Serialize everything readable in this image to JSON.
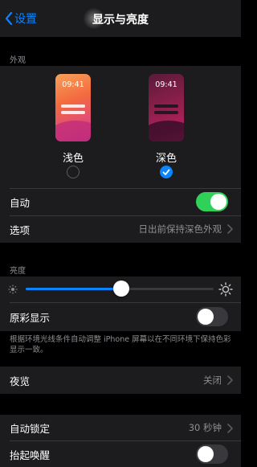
{
  "nav": {
    "back_label": "设置",
    "title": "显示与亮度"
  },
  "appearance": {
    "header": "外观",
    "light": {
      "label": "浅色",
      "time": "09:41",
      "selected": false
    },
    "dark": {
      "label": "深色",
      "time": "09:41",
      "selected": true
    },
    "auto": {
      "label": "自动",
      "on": true
    },
    "options": {
      "label": "选项",
      "value": "日出前保持深色外观"
    }
  },
  "brightness": {
    "header": "亮度",
    "level": 0.51,
    "true_tone": {
      "label": "原彩显示",
      "on": false,
      "footnote": "根据环境光线条件自动调整 iPhone 屏幕以在不同环境下保持色彩显示一致。"
    }
  },
  "night_shift": {
    "label": "夜览",
    "value": "关闭"
  },
  "auto_lock": {
    "label": "自动锁定",
    "value": "30 秒钟"
  },
  "raise_to_wake": {
    "label": "抬起唤醒",
    "on": false
  },
  "colors": {
    "accent": "#0a84ff",
    "toggle_on": "#30d158",
    "toggle_off": "#39393d"
  }
}
